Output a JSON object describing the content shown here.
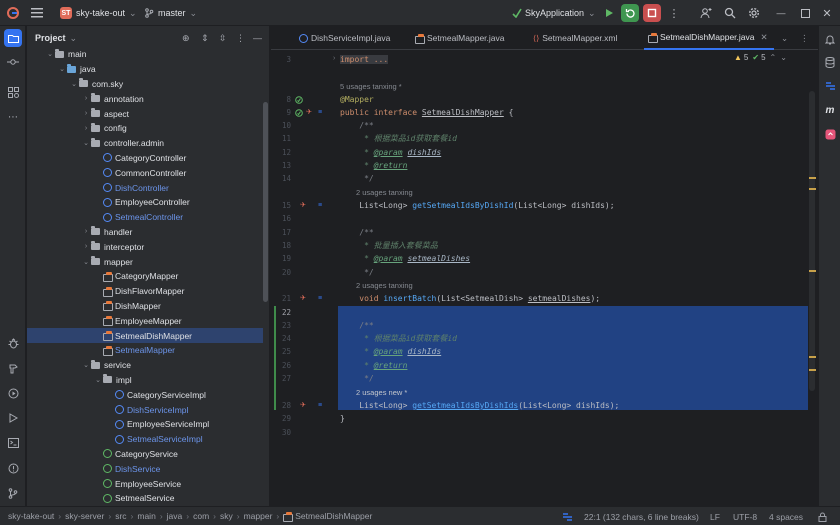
{
  "titlebar": {
    "project_badge": "ST",
    "project_name": "sky-take-out",
    "branch": "master",
    "run_config": "SkyApplication"
  },
  "project_panel": {
    "title": "Project",
    "tree": [
      {
        "label": "main",
        "kind": "folder",
        "depth": 2,
        "open": true,
        "color": "#a8abb2"
      },
      {
        "label": "java",
        "kind": "folder",
        "depth": 3,
        "open": true,
        "color": "#6aa5d8"
      },
      {
        "label": "com.sky",
        "kind": "folder",
        "depth": 4,
        "open": true,
        "color": "#a8abb2"
      },
      {
        "label": "annotation",
        "kind": "folder",
        "depth": 5,
        "open": false,
        "color": "#a8abb2"
      },
      {
        "label": "aspect",
        "kind": "folder",
        "depth": 5,
        "open": false,
        "color": "#a8abb2"
      },
      {
        "label": "config",
        "kind": "folder",
        "depth": 5,
        "open": false,
        "color": "#a8abb2"
      },
      {
        "label": "controller.admin",
        "kind": "folder",
        "depth": 5,
        "open": true,
        "color": "#a8abb2"
      },
      {
        "label": "CategoryController",
        "kind": "class",
        "depth": 6
      },
      {
        "label": "CommonController",
        "kind": "class",
        "depth": 6
      },
      {
        "label": "DishController",
        "kind": "class",
        "depth": 6,
        "changed": true
      },
      {
        "label": "EmployeeController",
        "kind": "class",
        "depth": 6
      },
      {
        "label": "SetmealController",
        "kind": "class",
        "depth": 6,
        "changed": true
      },
      {
        "label": "handler",
        "kind": "folder",
        "depth": 5,
        "open": false,
        "color": "#a8abb2"
      },
      {
        "label": "interceptor",
        "kind": "folder",
        "depth": 5,
        "open": false,
        "color": "#a8abb2"
      },
      {
        "label": "mapper",
        "kind": "folder",
        "depth": 5,
        "open": true,
        "color": "#a8abb2"
      },
      {
        "label": "CategoryMapper",
        "kind": "mapper",
        "depth": 6
      },
      {
        "label": "DishFlavorMapper",
        "kind": "mapper",
        "depth": 6
      },
      {
        "label": "DishMapper",
        "kind": "mapper",
        "depth": 6
      },
      {
        "label": "EmployeeMapper",
        "kind": "mapper",
        "depth": 6
      },
      {
        "label": "SetmealDishMapper",
        "kind": "mapper",
        "depth": 6,
        "selected": true
      },
      {
        "label": "SetmealMapper",
        "kind": "mapper",
        "depth": 6,
        "changed": true
      },
      {
        "label": "service",
        "kind": "folder",
        "depth": 5,
        "open": true,
        "color": "#a8abb2"
      },
      {
        "label": "impl",
        "kind": "folder",
        "depth": 6,
        "open": true,
        "color": "#a8abb2"
      },
      {
        "label": "CategoryServiceImpl",
        "kind": "class",
        "depth": 7
      },
      {
        "label": "DishServiceImpl",
        "kind": "class",
        "depth": 7,
        "changed": true
      },
      {
        "label": "EmployeeServiceImpl",
        "kind": "class",
        "depth": 7
      },
      {
        "label": "SetmealServiceImpl",
        "kind": "class",
        "depth": 7,
        "changed": true
      },
      {
        "label": "CategoryService",
        "kind": "interface",
        "depth": 6
      },
      {
        "label": "DishService",
        "kind": "interface",
        "depth": 6,
        "changed": true
      },
      {
        "label": "EmployeeService",
        "kind": "interface",
        "depth": 6
      },
      {
        "label": "SetmealService",
        "kind": "interface",
        "depth": 6
      }
    ]
  },
  "tabs": [
    {
      "label": "DishServiceImpl.java",
      "active": false
    },
    {
      "label": "SetmealMapper.java",
      "active": false
    },
    {
      "label": "SetmealMapper.xml",
      "active": false
    },
    {
      "label": "SetmealDishMapper.java",
      "active": true
    }
  ],
  "inspections": {
    "warnings": "5",
    "weak": "5"
  },
  "line_numbers": [
    "3",
    "8",
    "9",
    "10",
    "11",
    "12",
    "13",
    "14",
    "15",
    "16",
    "17",
    "18",
    "19",
    "20",
    "21",
    "22",
    "23",
    "24",
    "25",
    "26",
    "27",
    "28",
    "29",
    "30"
  ],
  "code": {
    "l3": "import ...",
    "hint1": "5 usages   tanxing *",
    "l8": "@Mapper",
    "l9_kw": "public interface ",
    "l9_name": "SetmealDishMapper",
    "l9_end": " {",
    "l10": "    /**",
    "l11": "     * 根据菜品id获取套餐id",
    "l12_tag": "@param",
    "l12_val": "dishIds",
    "l13_tag": "@return",
    "l14": "     */",
    "hint2": "2 usages   tanxing",
    "l15_a": "    List<Long> ",
    "l15_fn": "getSetmealIdsByDishId",
    "l15_b": "(List<Long> dishIds);",
    "l17": "    /**",
    "l18": "     * 批量插入套餐菜品",
    "l19_tag": "@param",
    "l19_val": "setmealDishes",
    "l20": "     */",
    "hint3": "2 usages   tanxing",
    "l21_kw": "    void ",
    "l21_fn": "insertBatch",
    "l21_b": "(List<SetmealDish> ",
    "l21_p": "setmealDishes",
    "l21_c": ");",
    "l23": "    /**",
    "l24": "     * 根据菜品id获取套餐id",
    "l25_tag": "@param",
    "l25_val": "dishIds",
    "l26_tag": "@return",
    "l27": "     */",
    "hint4": "2 usages   new *",
    "l28_a": "    List<Long> ",
    "l28_fn": "getSetmealIdsByDishIds",
    "l28_b": "(List<Long> dishIds);",
    "l29": "}"
  },
  "statusbar": {
    "breadcrumbs": [
      "sky-take-out",
      "sky-server",
      "src",
      "main",
      "java",
      "com",
      "sky",
      "mapper",
      "SetmealDishMapper"
    ],
    "position": "22:1 (132 chars, 6 line breaks)",
    "line_sep": "LF",
    "encoding": "UTF-8",
    "indent": "4 spaces"
  },
  "colors": {
    "accent": "#3574f0",
    "selection": "#214283",
    "stop": "#db5c5c",
    "debug": "#5fb865"
  }
}
